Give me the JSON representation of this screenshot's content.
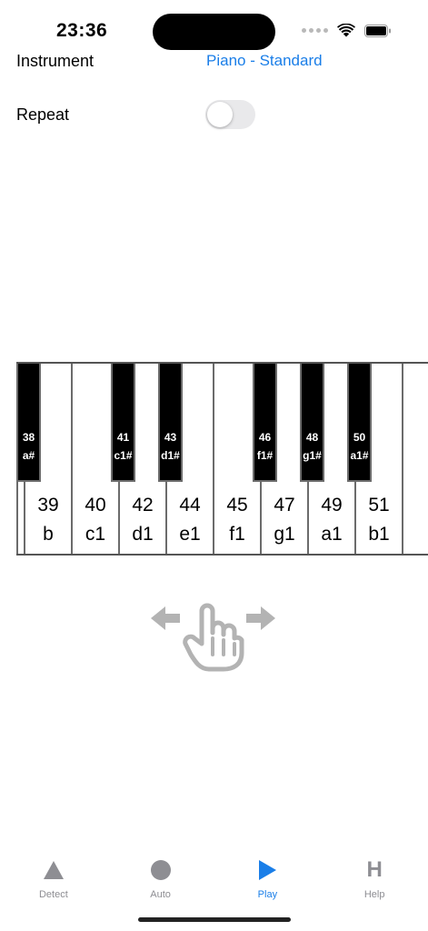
{
  "status_bar": {
    "time": "23:36"
  },
  "settings": {
    "instrument_label": "Instrument",
    "instrument_value": "Piano - Standard",
    "repeat_label": "Repeat",
    "repeat_on": false
  },
  "keyboard": {
    "white_keys": [
      {
        "num": "",
        "note": ""
      },
      {
        "num": "39",
        "note": "b"
      },
      {
        "num": "40",
        "note": "c1"
      },
      {
        "num": "42",
        "note": "d1"
      },
      {
        "num": "44",
        "note": "e1"
      },
      {
        "num": "45",
        "note": "f1"
      },
      {
        "num": "47",
        "note": "g1"
      },
      {
        "num": "49",
        "note": "a1"
      },
      {
        "num": "51",
        "note": "b1"
      },
      {
        "num": "",
        "note": ""
      }
    ],
    "black_keys": [
      {
        "num": "38",
        "note": "a#"
      },
      {
        "num": "41",
        "note": "c1#"
      },
      {
        "num": "43",
        "note": "d1#"
      },
      {
        "num": "46",
        "note": "f1#"
      },
      {
        "num": "48",
        "note": "g1#"
      },
      {
        "num": "50",
        "note": "a1#"
      }
    ]
  },
  "tabs": [
    {
      "label": "Detect",
      "icon": "triangle-icon",
      "active": false
    },
    {
      "label": "Auto",
      "icon": "circle-icon",
      "active": false
    },
    {
      "label": "Play",
      "icon": "play-icon",
      "active": true
    },
    {
      "label": "Help",
      "icon": "help-icon",
      "glyph": "H",
      "active": false
    }
  ],
  "colors": {
    "accent": "#1a7ee8",
    "tab_inactive": "#8e8e93",
    "toggle_off": "#e9e9eb",
    "swipe_hint": "#b3b3b3"
  }
}
